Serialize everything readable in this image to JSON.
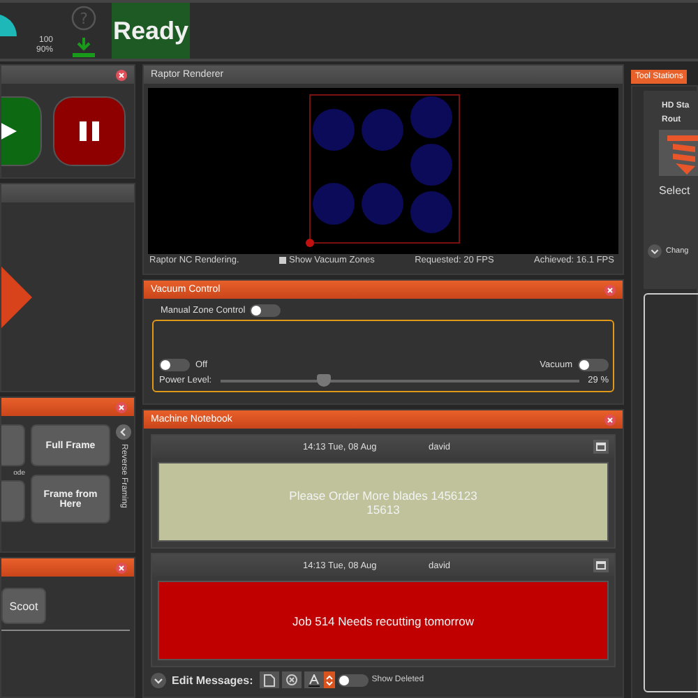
{
  "top_bar": {
    "gauge_value": "100",
    "gauge_label": "90%",
    "status": "Ready",
    "help_glyph": "?"
  },
  "framing_panel": {
    "mode_label": "ode",
    "buttons": [
      "Full Frame",
      "Frame from Here"
    ],
    "side_label": "Reverse Framing"
  },
  "scoot_panel": {
    "button": "Scoot"
  },
  "renderer": {
    "title": "Raptor Renderer",
    "status": "Raptor NC Rendering.",
    "show_vacuum_zones": {
      "label": "Show Vacuum Zones",
      "checked": true
    },
    "requested": "Requested: 20 FPS",
    "achieved": "Achieved: 16.1 FPS"
  },
  "vacuum_control": {
    "title": "Vacuum Control",
    "manual_zone": {
      "label": "Manual Zone Control",
      "on": false
    },
    "pump": {
      "label": "Off",
      "on": false
    },
    "vacuum": {
      "label": "Vacuum",
      "on": false
    },
    "power": {
      "label": "Power Level:",
      "level": 0.29,
      "reading": "29 %"
    }
  },
  "notebook": {
    "title": "Machine Notebook",
    "messages": [
      {
        "time": "14:13 Tue, 08 Aug",
        "author": "david",
        "text": "Please Order More blades 1456123 15613",
        "color": "#bfc29a"
      },
      {
        "time": "14:13 Tue, 08 Aug",
        "author": "david",
        "text": "Job 514 Needs recutting tomorrow",
        "color": "#c00000"
      }
    ],
    "toolbar": {
      "label": "Edit Messages:",
      "show_deleted": {
        "label": "Show Deleted",
        "on": false
      }
    }
  },
  "tool_stations": {
    "tab": "Tool Stations",
    "station": "HD Sta",
    "tool": "Rout",
    "select": "Select",
    "change": "Chang"
  }
}
